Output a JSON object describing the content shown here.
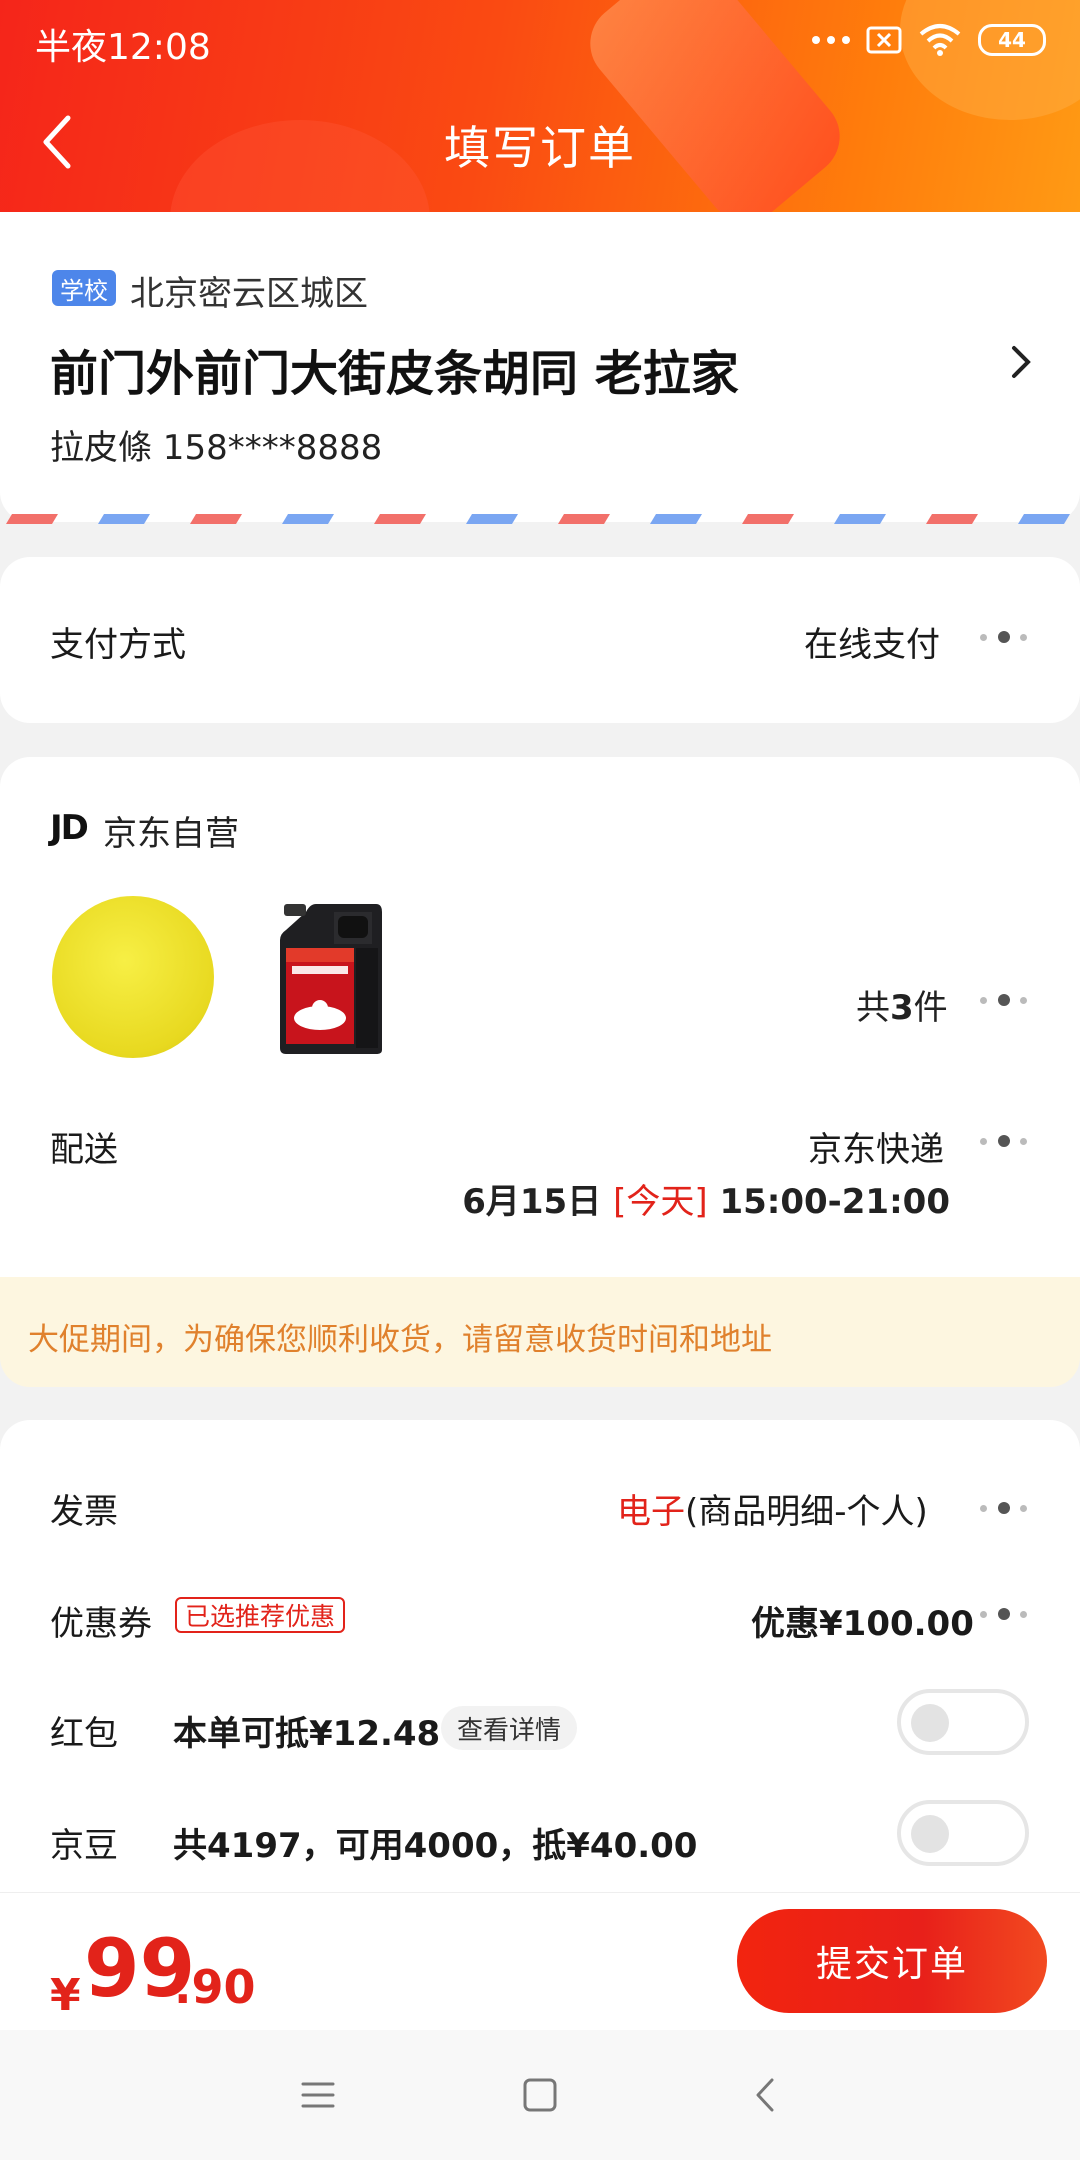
{
  "status_bar": {
    "time": "半夜12:08",
    "battery": "44"
  },
  "header": {
    "title": "填写订单"
  },
  "address": {
    "tag": "学校",
    "region": "北京密云区城区",
    "detail": "前门外前门大街皮条胡同  老拉家",
    "contact": "拉皮條  158****8888"
  },
  "payment": {
    "label": "支付方式",
    "value": "在线支付"
  },
  "shop": {
    "logo": "JD",
    "name": "京东自营"
  },
  "goods": {
    "count_prefix": "共",
    "count": "3",
    "count_suffix": "件",
    "items": [
      "yellow-sponge",
      "engine-oil-SN-5W-30"
    ]
  },
  "delivery": {
    "label": "配送",
    "method": "京东快递",
    "date": "6月15日",
    "today": "[今天]",
    "time": "15:00-21:00"
  },
  "notice": "大促期间，为确保您顺利收货，请留意收货时间和地址",
  "invoice": {
    "label": "发票",
    "type": "电子",
    "detail": "(商品明细-个人)"
  },
  "coupon": {
    "label": "优惠券",
    "tag": "已选推荐优惠",
    "value": "优惠¥100.00"
  },
  "red_packet": {
    "label": "红包",
    "value": "本单可抵¥12.48",
    "detail_btn": "查看详情",
    "enabled": false
  },
  "jd_beans": {
    "label": "京豆",
    "value": "共4197，可用4000，抵¥40.00",
    "enabled": false
  },
  "total": {
    "currency": "¥",
    "integer": "99",
    "decimal": ".90"
  },
  "submit_label": "提交订单",
  "colors": {
    "accent": "#e2231a",
    "header_start": "#f5251a",
    "header_end": "#ff9a14",
    "notice_text": "#e0812d",
    "tag_blue": "#4d86ea"
  },
  "icons": [
    "back-icon",
    "chevron-right-icon",
    "more-dots-icon",
    "wifi-icon",
    "sim-x-icon",
    "menu-icon",
    "home-icon",
    "nav-back-icon"
  ]
}
